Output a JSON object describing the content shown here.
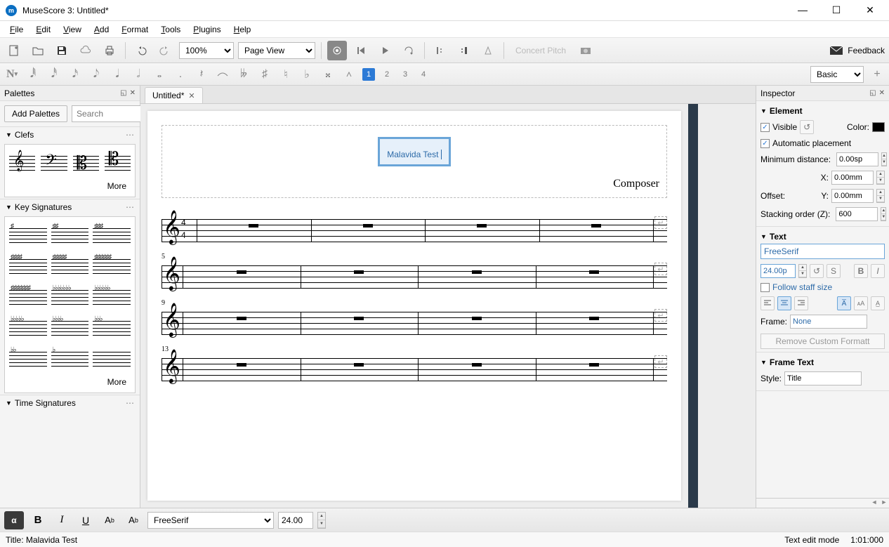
{
  "window": {
    "title": "MuseScore 3: Untitled*"
  },
  "menu": [
    "File",
    "Edit",
    "View",
    "Add",
    "Format",
    "Tools",
    "Plugins",
    "Help"
  ],
  "toolbar": {
    "zoom": "100%",
    "view_mode": "Page View",
    "concert_pitch": "Concert Pitch",
    "feedback": "Feedback"
  },
  "toolbar2": {
    "voices": [
      "1",
      "2",
      "3",
      "4"
    ],
    "active_voice": 0,
    "workspace": "Basic"
  },
  "palettes": {
    "title": "Palettes",
    "add_btn": "Add Palettes",
    "search_ph": "Search",
    "cat_clefs": "Clefs",
    "cat_keys": "Key Signatures",
    "cat_time": "Time Signatures",
    "more": "More"
  },
  "tab": {
    "label": "Untitled*"
  },
  "score": {
    "title_text": "Malavida Test",
    "composer": "Composer",
    "measure_nums": [
      "",
      "5",
      "9",
      "13"
    ],
    "time_sig_top": "4",
    "time_sig_bot": "4"
  },
  "inspector": {
    "title": "Inspector",
    "element": "Element",
    "visible": "Visible",
    "color_lbl": "Color:",
    "auto_place": "Automatic placement",
    "min_dist": "Minimum distance:",
    "min_dist_v": "0.00sp",
    "x_lbl": "X:",
    "x_v": "0.00mm",
    "y_lbl": "Y:",
    "y_v": "0.00mm",
    "offset": "Offset:",
    "stack": "Stacking order (Z):",
    "stack_v": "600",
    "text_hdr": "Text",
    "font": "FreeSerif",
    "size": "24.00p",
    "s_btn": "S",
    "follow": "Follow staff size",
    "frame_lbl": "Frame:",
    "frame_v": "None",
    "remove": "Remove Custom Formatt",
    "frametext_hdr": "Frame Text",
    "style_lbl": "Style:",
    "style_v": "Title"
  },
  "bottom": {
    "font": "FreeSerif",
    "size": "24.00"
  },
  "status": {
    "left": "Title: Malavida Test",
    "mode": "Text edit mode",
    "pos": "1:01:000"
  }
}
